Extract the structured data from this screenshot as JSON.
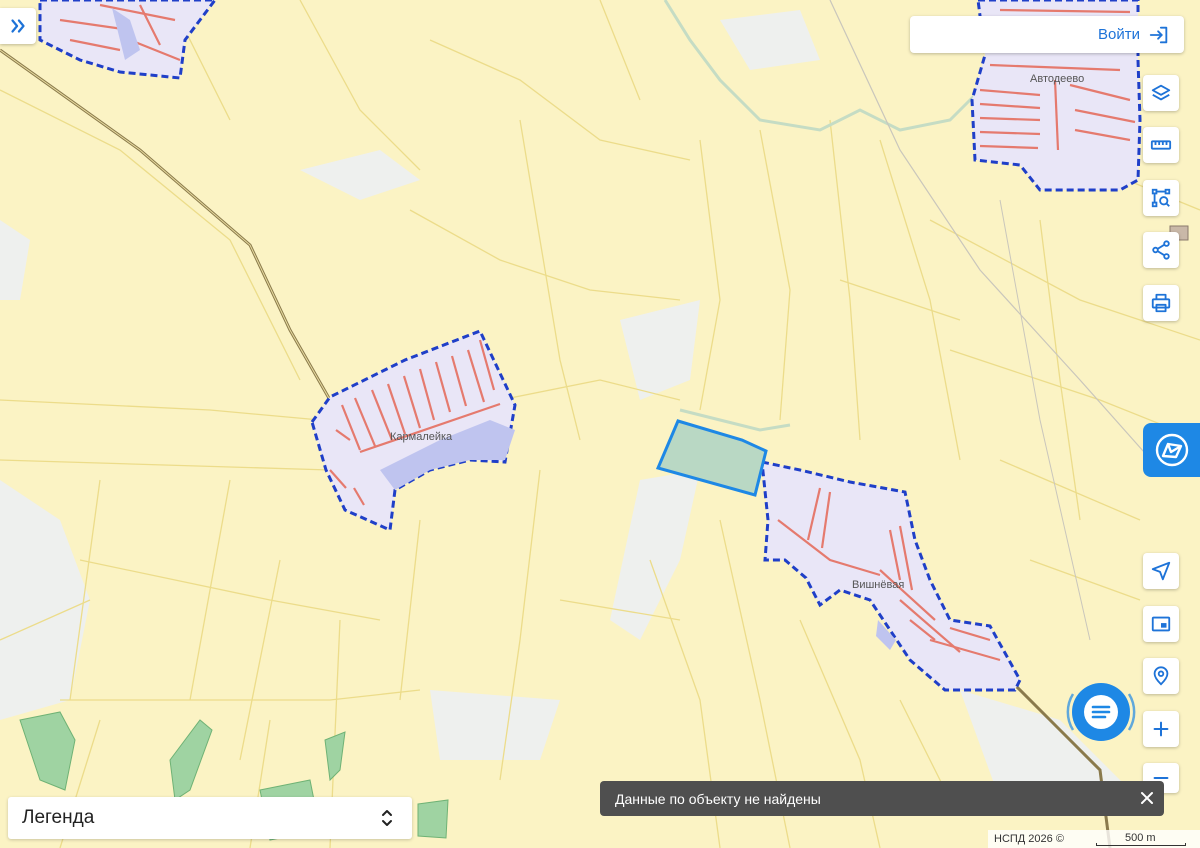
{
  "map": {
    "places": [
      {
        "label": "Кармалейка"
      },
      {
        "label": "Вишнёвая"
      },
      {
        "label": "Автодеево"
      }
    ]
  },
  "header": {
    "login_label": "Войти"
  },
  "legend": {
    "label": "Легенда"
  },
  "toast": {
    "message": "Данные по объекту не найдены"
  },
  "footer": {
    "attribution": "НСПД 2026 ©",
    "scale_label": "500 m"
  },
  "icons": {
    "expand": "double-chevron-right-icon",
    "login": "sign-in-icon",
    "layers": "layers-icon",
    "ruler": "ruler-icon",
    "select": "area-select-icon",
    "share": "share-icon",
    "print": "print-icon",
    "cadastral": "cadastral-map-icon",
    "locate": "navigation-arrow-icon",
    "minimap": "minimap-icon",
    "search_location": "location-search-icon",
    "zoom_in": "plus-icon",
    "zoom_out": "minus-icon",
    "chat": "chat-icon",
    "legend_toggle": "chevron-up-down-icon",
    "close": "close-icon"
  },
  "colors": {
    "field": "#fbf3c4",
    "plot_border": "#ecdc8a",
    "settlement_fill": "#e9e6f7",
    "settlement_border": "#1f3fc8",
    "building": "#e57a6e",
    "accent": "#1e88e5",
    "selected_parcel": "#b9d8c4"
  }
}
